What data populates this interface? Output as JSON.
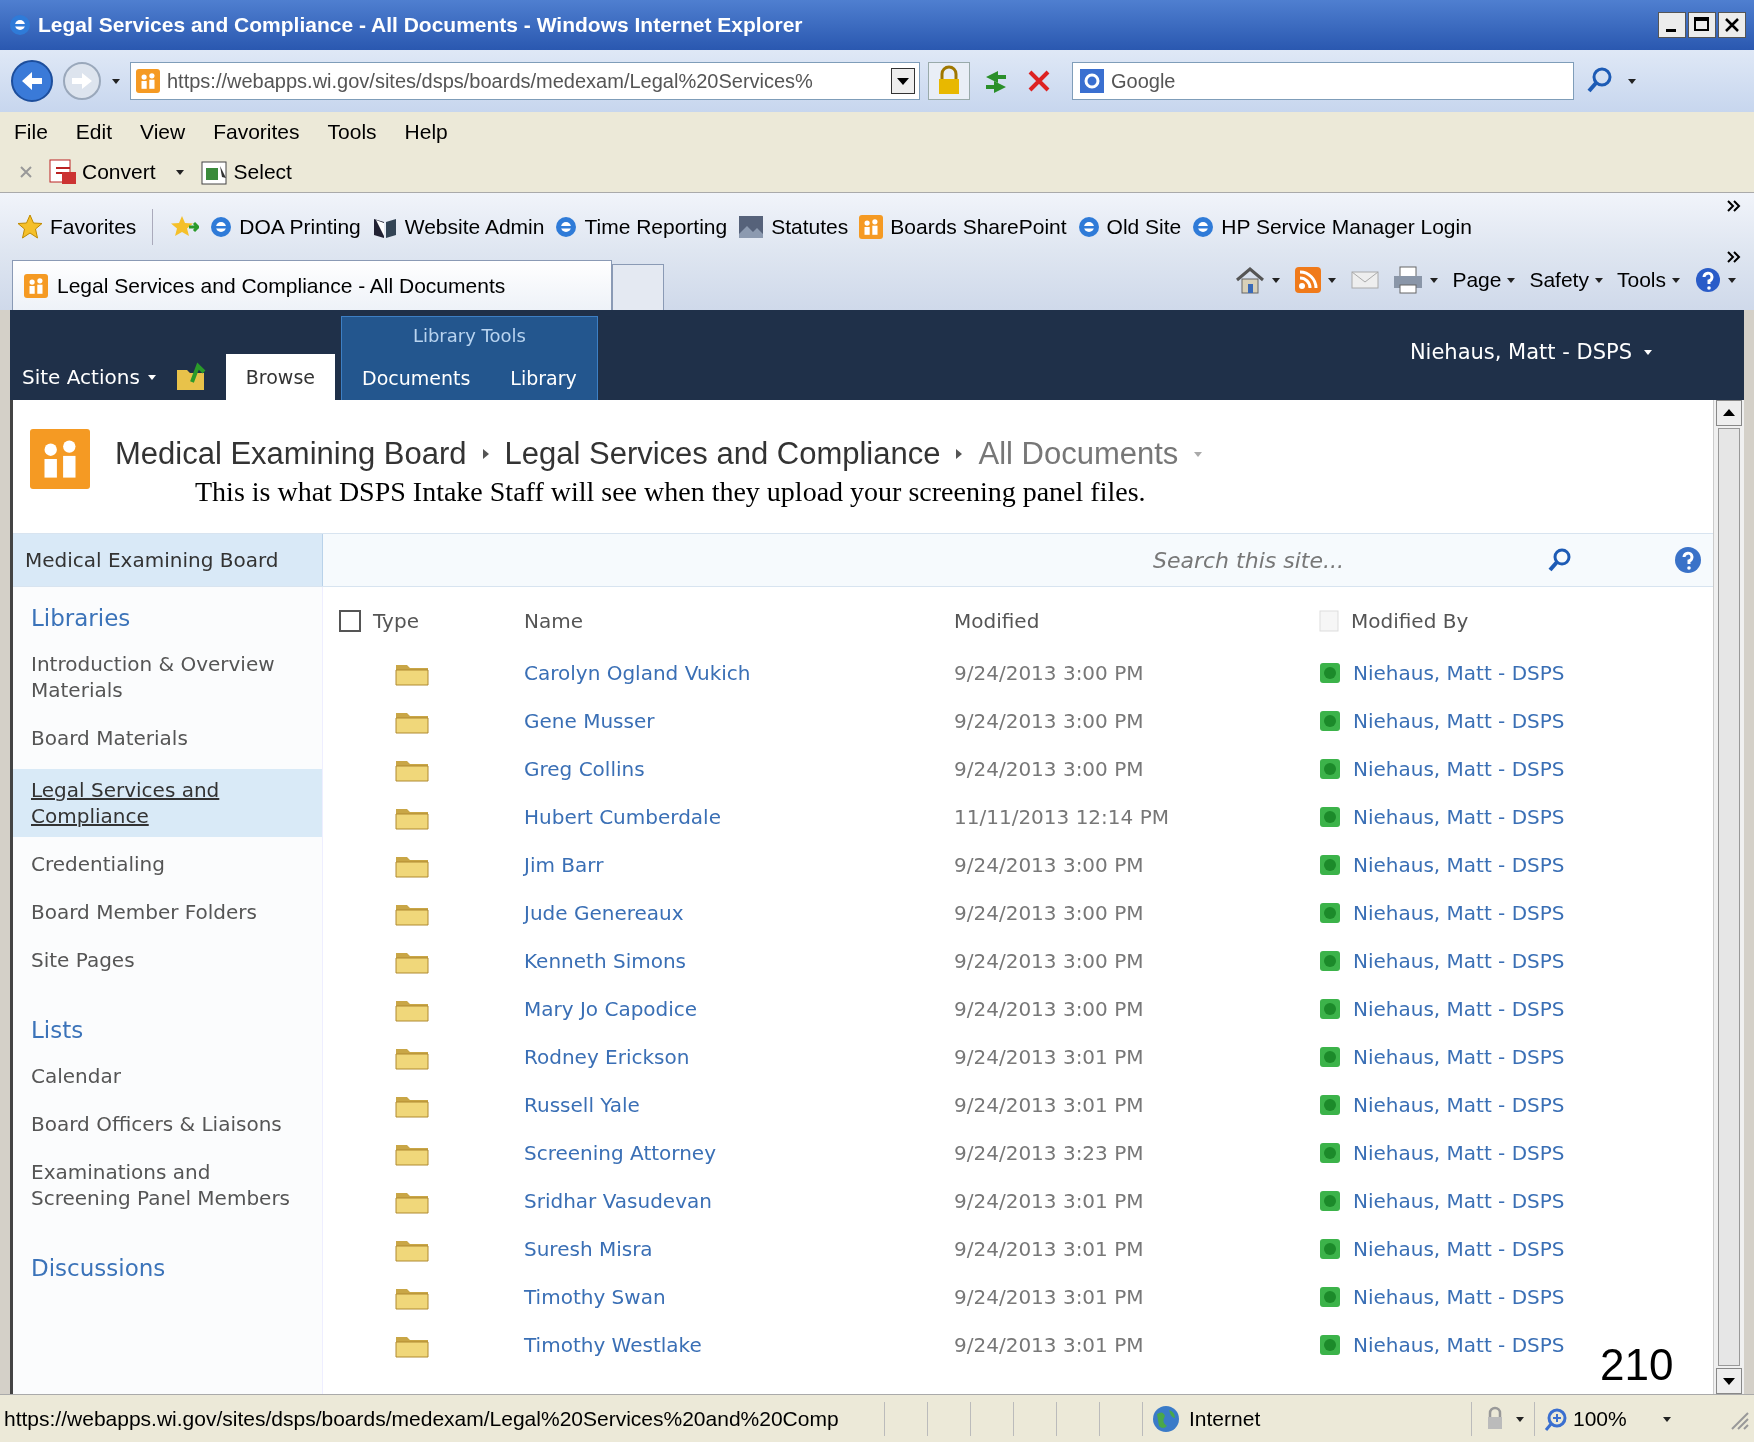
{
  "window": {
    "title": "Legal Services and Compliance - All Documents - Windows Internet Explorer"
  },
  "address_bar": {
    "url": "https://webapps.wi.gov/sites/dsps/boards/medexam/Legal%20Services%"
  },
  "search_box": {
    "value": "Google"
  },
  "menu": [
    "File",
    "Edit",
    "View",
    "Favorites",
    "Tools",
    "Help"
  ],
  "command_bar": [
    {
      "label": "Convert",
      "kind": "dropdown"
    },
    {
      "label": "Select",
      "kind": "button"
    }
  ],
  "favorites_bar": {
    "label": "Favorites",
    "links": [
      {
        "label": "DOA Printing",
        "kind": "ie"
      },
      {
        "label": "Website Admin",
        "kind": "page"
      },
      {
        "label": "Time Reporting",
        "kind": "ie"
      },
      {
        "label": "Statutes",
        "kind": "photo"
      },
      {
        "label": "Boards SharePoint",
        "kind": "sharepoint"
      },
      {
        "label": "Old Site",
        "kind": "ie"
      },
      {
        "label": "HP Service Manager Login",
        "kind": "ie"
      }
    ]
  },
  "browser_tabs": [
    {
      "label": "Legal Services and Compliance - All Documents",
      "selected": true
    }
  ],
  "toolbar": [
    "Page",
    "Safety",
    "Tools"
  ],
  "ribbon": {
    "site_actions": "Site Actions",
    "group_label": "Library Tools",
    "tabs": [
      {
        "label": "Browse",
        "selected": true
      },
      {
        "label": "Documents",
        "selected": false
      },
      {
        "label": "Library",
        "selected": false
      }
    ],
    "user": "Niehaus, Matt - DSPS"
  },
  "breadcrumb": [
    "Medical Examining Board",
    "Legal Services and Compliance",
    "All Documents"
  ],
  "annotation": "This is what DSPS Intake Staff will see when they upload your screening panel files.",
  "site_nav": {
    "home_tab": "Medical Examining Board",
    "search_placeholder": "Search this site..."
  },
  "quick_launch": [
    {
      "heading": "Libraries",
      "items": [
        {
          "label": "Introduction & Overview Materials",
          "selected": false
        },
        {
          "label": "Board Materials",
          "selected": false
        },
        {
          "label": "Legal Services and Compliance",
          "selected": true
        },
        {
          "label": "Credentialing",
          "selected": false
        },
        {
          "label": "Board Member Folders",
          "selected": false
        },
        {
          "label": "Site Pages",
          "selected": false
        }
      ]
    },
    {
      "heading": "Lists",
      "items": [
        {
          "label": "Calendar",
          "selected": false
        },
        {
          "label": "Board Officers & Liaisons",
          "selected": false
        },
        {
          "label": "Examinations and Screening Panel Members",
          "selected": false
        }
      ]
    },
    {
      "heading": "Discussions"
    }
  ],
  "table": {
    "select_all_checked": false,
    "columns": [
      "Type",
      "Name",
      "Modified",
      "Modified By"
    ],
    "rows": [
      {
        "name": "Carolyn Ogland Vukich",
        "modified": "9/24/2013 3:00 PM",
        "modified_by": "Niehaus, Matt - DSPS"
      },
      {
        "name": "Gene Musser",
        "modified": "9/24/2013 3:00 PM",
        "modified_by": "Niehaus, Matt - DSPS"
      },
      {
        "name": "Greg Collins",
        "modified": "9/24/2013 3:00 PM",
        "modified_by": "Niehaus, Matt - DSPS"
      },
      {
        "name": "Hubert Cumberdale",
        "modified": "11/11/2013 12:14 PM",
        "modified_by": "Niehaus, Matt - DSPS"
      },
      {
        "name": "Jim Barr",
        "modified": "9/24/2013 3:00 PM",
        "modified_by": "Niehaus, Matt - DSPS"
      },
      {
        "name": "Jude Genereaux",
        "modified": "9/24/2013 3:00 PM",
        "modified_by": "Niehaus, Matt - DSPS"
      },
      {
        "name": "Kenneth Simons",
        "modified": "9/24/2013 3:00 PM",
        "modified_by": "Niehaus, Matt - DSPS"
      },
      {
        "name": "Mary Jo Capodice",
        "modified": "9/24/2013 3:00 PM",
        "modified_by": "Niehaus, Matt - DSPS"
      },
      {
        "name": "Rodney Erickson",
        "modified": "9/24/2013 3:01 PM",
        "modified_by": "Niehaus, Matt - DSPS"
      },
      {
        "name": "Russell Yale",
        "modified": "9/24/2013 3:01 PM",
        "modified_by": "Niehaus, Matt - DSPS"
      },
      {
        "name": "Screening Attorney",
        "modified": "9/24/2013 3:23 PM",
        "modified_by": "Niehaus, Matt - DSPS"
      },
      {
        "name": "Sridhar Vasudevan",
        "modified": "9/24/2013 3:01 PM",
        "modified_by": "Niehaus, Matt - DSPS"
      },
      {
        "name": "Suresh Misra",
        "modified": "9/24/2013 3:01 PM",
        "modified_by": "Niehaus, Matt - DSPS"
      },
      {
        "name": "Timothy Swan",
        "modified": "9/24/2013 3:01 PM",
        "modified_by": "Niehaus, Matt - DSPS"
      },
      {
        "name": "Timothy Westlake",
        "modified": "9/24/2013 3:01 PM",
        "modified_by": "Niehaus, Matt - DSPS"
      }
    ]
  },
  "status_bar": {
    "url": "https://webapps.wi.gov/sites/dsps/boards/medexam/Legal%20Services%20and%20Comp",
    "zone": "Internet",
    "zoom": "100%"
  },
  "page_number": "210"
}
